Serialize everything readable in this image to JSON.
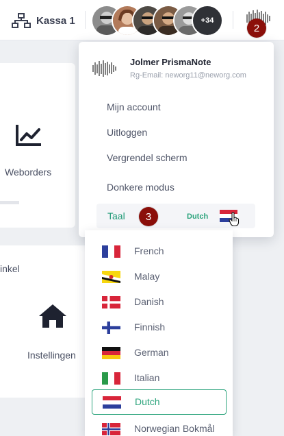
{
  "header": {
    "register_label": "Kassa 1",
    "more_users_count": "+34"
  },
  "badges": {
    "step2": "2",
    "step3": "3"
  },
  "background": {
    "weborders_label": "Weborders",
    "partial_shop_label": "inkel",
    "settings_label": "Instellingen"
  },
  "user_menu": {
    "name": "Jolmer PrismaNote",
    "email": "Rg-Email: neworg11@neworg.com",
    "items": [
      "Mijn account",
      "Uitloggen",
      "Vergrendel scherm",
      "Donkere modus"
    ],
    "language_label": "Taal",
    "current_language": "Dutch"
  },
  "languages": [
    {
      "name": "French",
      "flag": "fr"
    },
    {
      "name": "Malay",
      "flag": "bn"
    },
    {
      "name": "Danish",
      "flag": "dk"
    },
    {
      "name": "Finnish",
      "flag": "fi"
    },
    {
      "name": "German",
      "flag": "de"
    },
    {
      "name": "Italian",
      "flag": "it"
    },
    {
      "name": "Dutch",
      "flag": "nl",
      "selected": true
    },
    {
      "name": "Norwegian Bokmål",
      "flag": "no"
    }
  ],
  "colors": {
    "accent_green": "#2aa37b",
    "badge_red": "#8b0f0a"
  }
}
